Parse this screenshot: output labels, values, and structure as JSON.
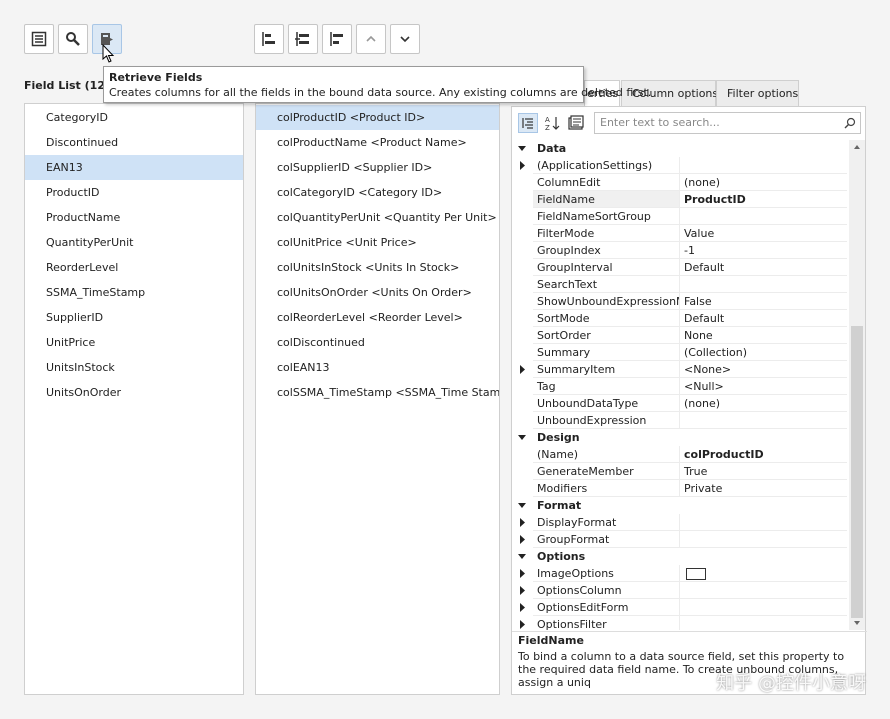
{
  "toolbar": {
    "left_buttons": [
      "list-view-icon",
      "search-icon",
      "retrieve-fields-icon"
    ],
    "right_buttons": [
      "add-column-icon",
      "insert-column-icon",
      "remove-column-icon",
      "move-up-icon",
      "move-down-icon"
    ]
  },
  "tooltip": {
    "title": "Retrieve Fields",
    "body": "Creates columns for all the fields in the bound data source. Any existing columns are deleted first."
  },
  "field_list": {
    "title": "Field List (12)",
    "items": [
      "CategoryID",
      "Discontinued",
      "EAN13",
      "ProductID",
      "ProductName",
      "QuantityPerUnit",
      "ReorderLevel",
      "SSMA_TimeStamp",
      "SupplierID",
      "UnitPrice",
      "UnitsInStock",
      "UnitsOnOrder"
    ],
    "selected_index": 2
  },
  "columns_list": {
    "items": [
      "colProductID <Product ID>",
      "colProductName <Product Name>",
      "colSupplierID <Supplier ID>",
      "colCategoryID <Category ID>",
      "colQuantityPerUnit <Quantity Per Unit>",
      "colUnitPrice <Unit Price>",
      "colUnitsInStock <Units In Stock>",
      "colUnitsOnOrder <Units On Order>",
      "colReorderLevel <Reorder Level>",
      "colDiscontinued",
      "colEAN13",
      "colSSMA_TimeStamp <SSMA_Time Stamp>"
    ],
    "selected_index": 0
  },
  "tabs": [
    "Properties",
    "Column options",
    "Filter options"
  ],
  "tabs_visible_text": "erties",
  "property_grid": {
    "search_placeholder": "Enter text to search...",
    "rows": [
      {
        "type": "cat",
        "name": "Data",
        "expanded": true
      },
      {
        "type": "prop",
        "name": "(ApplicationSettings)",
        "value": "",
        "expandable": true
      },
      {
        "type": "prop",
        "name": "ColumnEdit",
        "value": "(none)"
      },
      {
        "type": "prop",
        "name": "FieldName",
        "value": "ProductID",
        "bold": true,
        "selected": true
      },
      {
        "type": "prop",
        "name": "FieldNameSortGroup",
        "value": ""
      },
      {
        "type": "prop",
        "name": "FilterMode",
        "value": "Value"
      },
      {
        "type": "prop",
        "name": "GroupIndex",
        "value": "-1"
      },
      {
        "type": "prop",
        "name": "GroupInterval",
        "value": "Default"
      },
      {
        "type": "prop",
        "name": "SearchText",
        "value": ""
      },
      {
        "type": "prop",
        "name": "ShowUnboundExpressionMenu",
        "value": "False"
      },
      {
        "type": "prop",
        "name": "SortMode",
        "value": "Default"
      },
      {
        "type": "prop",
        "name": "SortOrder",
        "value": "None"
      },
      {
        "type": "prop",
        "name": "Summary",
        "value": "(Collection)"
      },
      {
        "type": "prop",
        "name": "SummaryItem",
        "value": "<None>",
        "expandable": true
      },
      {
        "type": "prop",
        "name": "Tag",
        "value": "<Null>"
      },
      {
        "type": "prop",
        "name": "UnboundDataType",
        "value": "(none)"
      },
      {
        "type": "prop",
        "name": "UnboundExpression",
        "value": ""
      },
      {
        "type": "cat",
        "name": "Design",
        "expanded": true
      },
      {
        "type": "prop",
        "name": "(Name)",
        "value": "colProductID",
        "bold": true
      },
      {
        "type": "prop",
        "name": "GenerateMember",
        "value": "True"
      },
      {
        "type": "prop",
        "name": "Modifiers",
        "value": "Private"
      },
      {
        "type": "cat",
        "name": "Format",
        "expanded": true
      },
      {
        "type": "prop",
        "name": "DisplayFormat",
        "value": "",
        "expandable": true
      },
      {
        "type": "prop",
        "name": "GroupFormat",
        "value": "",
        "expandable": true
      },
      {
        "type": "cat",
        "name": "Options",
        "expanded": true
      },
      {
        "type": "prop",
        "name": "ImageOptions",
        "value": "",
        "expandable": true,
        "image_box": true
      },
      {
        "type": "prop",
        "name": "OptionsColumn",
        "value": "",
        "expandable": true
      },
      {
        "type": "prop",
        "name": "OptionsEditForm",
        "value": "",
        "expandable": true
      },
      {
        "type": "prop",
        "name": "OptionsFilter",
        "value": "",
        "expandable": true
      }
    ],
    "description_title": "FieldName",
    "description_text": "To bind a column to a data source field, set this property to the required data field name. To create unbound columns, assign a uniq"
  },
  "watermark": "知乎 @控件小意呀"
}
